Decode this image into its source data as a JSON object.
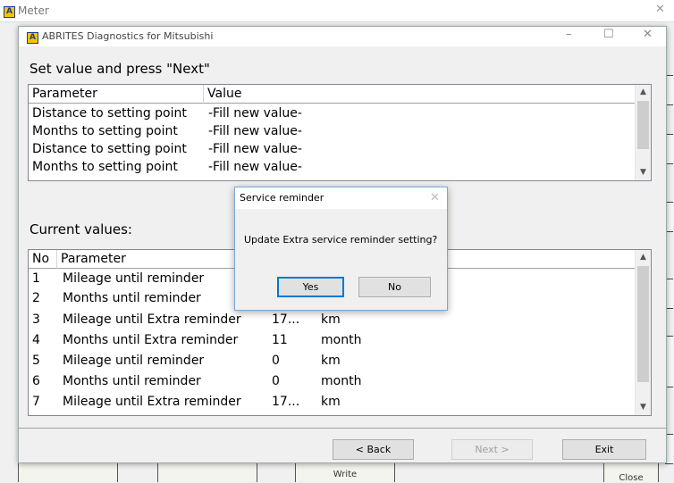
{
  "outer": {
    "title": "Meter"
  },
  "dialog": {
    "title": "ABRITES Diagnostics for Mitsubishi",
    "heading": "Set value and press \"Next\"",
    "set_table": {
      "headers": [
        "Parameter",
        "Value"
      ],
      "rows": [
        [
          "Distance to setting point",
          "-Fill new value-"
        ],
        [
          "Months to setting point",
          "-Fill new value-"
        ],
        [
          "Distance to setting point",
          "-Fill new value-"
        ],
        [
          "Months to setting point",
          "-Fill new value-"
        ]
      ]
    },
    "current_heading": "Current values:",
    "current_table": {
      "headers": [
        "No",
        "Parameter"
      ],
      "rows": [
        [
          "1",
          "Mileage until reminder",
          "",
          ""
        ],
        [
          "2",
          "Months until reminder",
          "",
          ""
        ],
        [
          "3",
          "Mileage until Extra reminder",
          "17...",
          "km"
        ],
        [
          "4",
          "Months until Extra reminder",
          "11",
          "month"
        ],
        [
          "5",
          "Mileage until reminder",
          "0",
          "km"
        ],
        [
          "6",
          "Months until reminder",
          "0",
          "month"
        ],
        [
          "7",
          "Mileage until Extra reminder",
          "17...",
          "km"
        ]
      ]
    },
    "buttons": {
      "back": "< Back",
      "next": "Next >",
      "exit": "Exit"
    }
  },
  "popup": {
    "title": "Service reminder",
    "message": "Update Extra service reminder setting?",
    "yes": "Yes",
    "no": "No"
  },
  "background": {
    "write_label": "Write",
    "close_label": "Close"
  }
}
